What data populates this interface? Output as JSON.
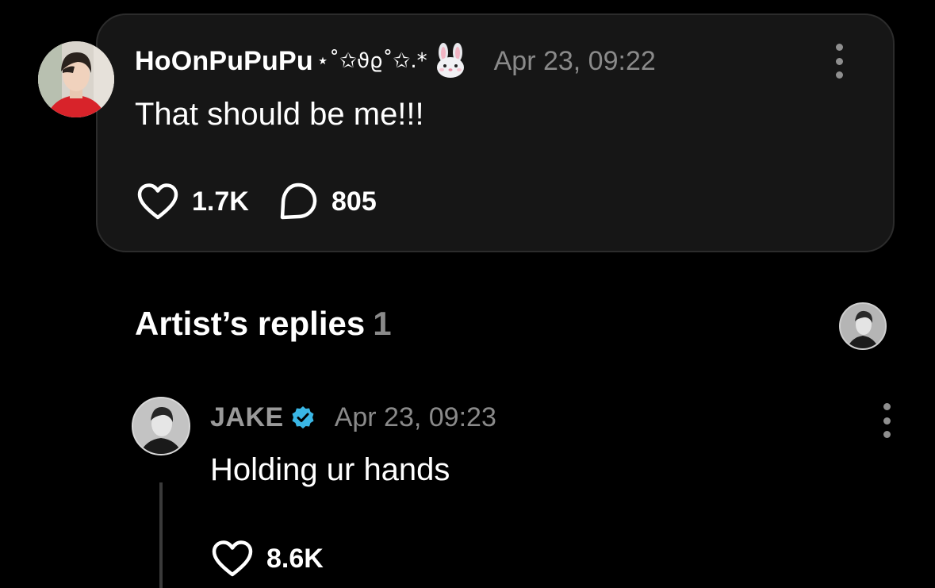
{
  "post": {
    "username": "HoOnPuPuPu",
    "username_decoration": "⋆˚✩ϑϱ˚✩.*",
    "emoji_icon": "rabbit-face-icon",
    "timestamp": "Apr 23, 09:22",
    "text": "That should be me!!!",
    "likes": "1.7K",
    "comments": "805"
  },
  "artist_replies": {
    "heading": "Artist’s replies",
    "count": "1"
  },
  "reply": {
    "author": "JAKE",
    "verified": true,
    "timestamp": "Apr 23, 09:23",
    "text": "Holding ur hands",
    "likes": "8.6K"
  },
  "colors": {
    "background": "#000000",
    "card_background": "#161616",
    "card_border": "#2c2c2c",
    "muted_text": "#8a8a8a",
    "verified_badge": "#3ab7e6"
  }
}
